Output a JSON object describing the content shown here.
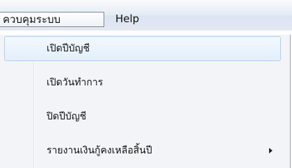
{
  "menubar": {
    "items": [
      {
        "label": "ควบคุมระบบ",
        "active": true
      },
      {
        "label": "Help",
        "active": false
      }
    ]
  },
  "dropdown": {
    "items": [
      {
        "label": "เปิดปีบัญชี",
        "highlighted": true,
        "has_submenu": false
      },
      {
        "label": "เปิดวันทำการ",
        "highlighted": false,
        "has_submenu": false
      },
      {
        "label": "ปิดปีบัญชี",
        "highlighted": false,
        "has_submenu": false
      },
      {
        "label": "รายงานเงินกู้คงเหลือสิ้นปี",
        "highlighted": false,
        "has_submenu": true
      }
    ]
  },
  "icons": {
    "submenu_arrow": "chevron-right-icon"
  }
}
